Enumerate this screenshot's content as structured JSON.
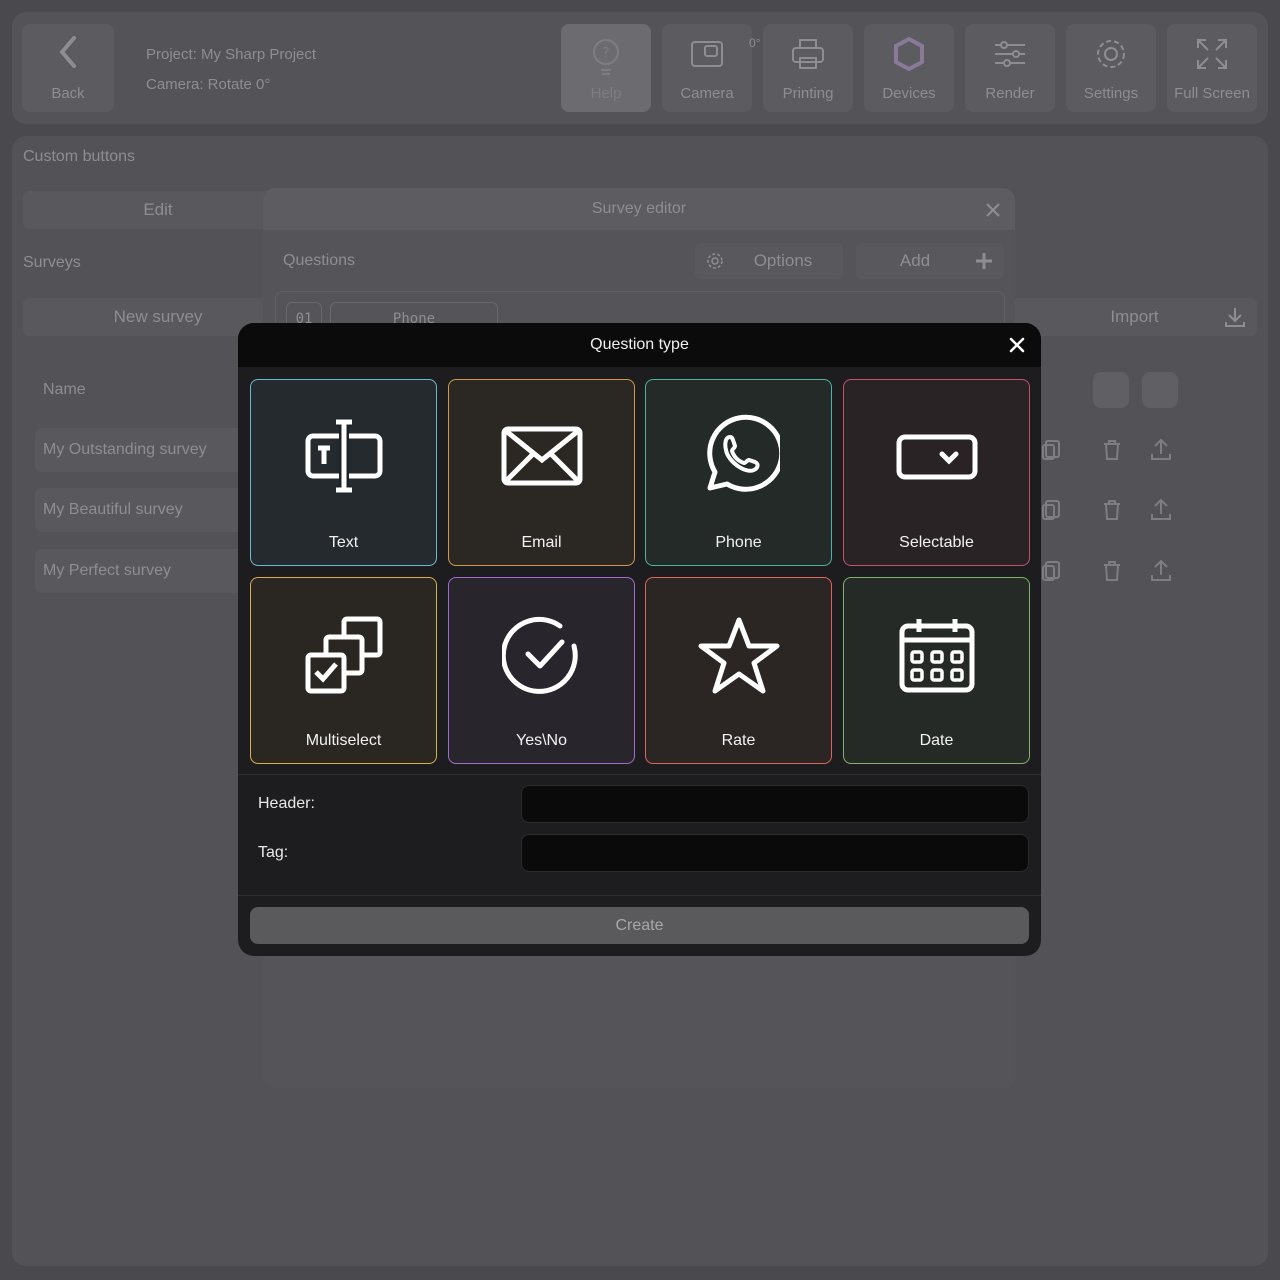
{
  "topbar": {
    "back_label": "Back",
    "project_line": "Project: My Sharp Project",
    "camera_line": "Camera: Rotate 0°",
    "camera_badge": "0°",
    "buttons": {
      "help": "Help",
      "camera": "Camera",
      "printing": "Printing",
      "devices": "Devices",
      "render": "Render",
      "settings": "Settings",
      "fullscreen": "Full Screen"
    }
  },
  "background": {
    "custom_buttons_label": "Custom buttons",
    "edit_label": "Edit",
    "surveys_label": "Surveys",
    "new_survey_label": "New survey",
    "import_label": "Import",
    "table_header": "Name",
    "surveys": [
      "My Outstanding survey",
      "My Beautiful survey",
      "My Perfect survey"
    ]
  },
  "editor": {
    "title": "Survey editor",
    "questions_label": "Questions",
    "options_label": "Options",
    "add_label": "Add",
    "row_number": "01",
    "row_type": "Phone"
  },
  "modal": {
    "title": "Question type",
    "types": [
      {
        "label": "Text",
        "icon": "text-field-icon",
        "color": "#6fb8c9",
        "bg": "#252a2e"
      },
      {
        "label": "Email",
        "icon": "envelope-icon",
        "color": "#d19a4a",
        "bg": "#2b2722"
      },
      {
        "label": "Phone",
        "icon": "whatsapp-phone-icon",
        "color": "#4fb3a0",
        "bg": "#232a28"
      },
      {
        "label": "Selectable",
        "icon": "dropdown-select-icon",
        "color": "#c94e6a",
        "bg": "#2a2326"
      },
      {
        "label": "Multiselect",
        "icon": "multiselect-icon",
        "color": "#d6b04a",
        "bg": "#2a2722"
      },
      {
        "label": "Yes\\No",
        "icon": "check-circle-icon",
        "color": "#a06cc9",
        "bg": "#29252d"
      },
      {
        "label": "Rate",
        "icon": "star-icon",
        "color": "#d9665a",
        "bg": "#2b2524"
      },
      {
        "label": "Date",
        "icon": "calendar-icon",
        "color": "#7fb36a",
        "bg": "#252a26"
      }
    ],
    "header_label": "Header:",
    "tag_label": "Tag:",
    "header_value": "",
    "tag_value": "",
    "create_label": "Create"
  }
}
